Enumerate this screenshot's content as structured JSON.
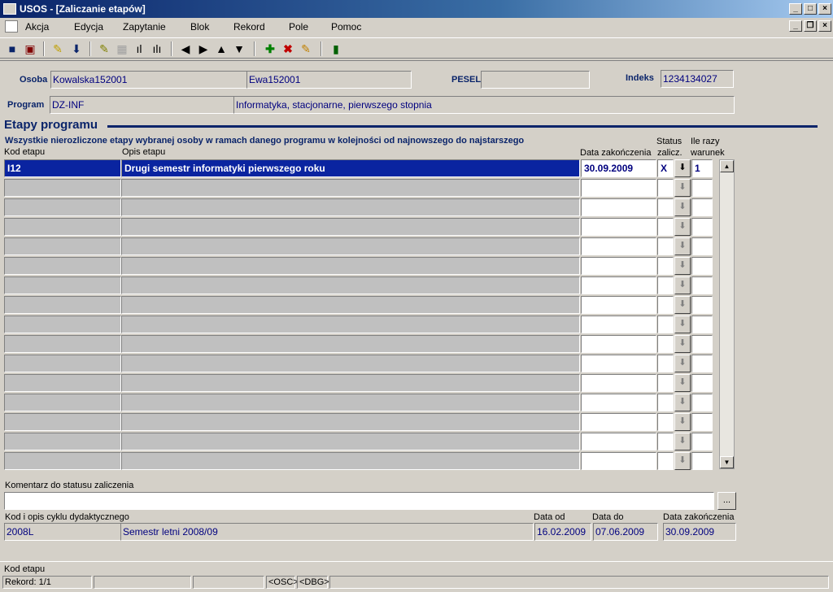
{
  "window": {
    "title": "USOS - [Zaliczanie etapów]"
  },
  "menu": [
    "Akcja",
    "Edycja",
    "Zapytanie",
    "Blok",
    "Rekord",
    "Pole",
    "Pomoc"
  ],
  "toolbar_icons": [
    "save-icon",
    "print-icon",
    "edit-icon",
    "download-icon",
    "query-icon",
    "query-disabled-icon",
    "count-icon",
    "count-alt-icon",
    "prev-record-icon",
    "next-record-icon",
    "prev-block-icon",
    "next-block-icon",
    "insert-record-icon",
    "delete-record-icon",
    "clear-record-icon",
    "exit-icon"
  ],
  "form": {
    "osoba_label": "Osoba",
    "osoba_surname": "Kowalska152001",
    "osoba_name": "Ewa152001",
    "pesel_label": "PESEL",
    "pesel_value": "",
    "indeks_label": "Indeks",
    "indeks_value": "1234134027",
    "program_label": "Program",
    "program_code": "DZ-INF",
    "program_desc": "Informatyka, stacjonarne, pierwszego stopnia"
  },
  "etapy": {
    "section_title": "Etapy programu",
    "description": "Wszystkie nierozliczone etapy wybranej osoby w ramach danego programu w kolejności od najnowszego do najstarszego",
    "col_kod": "Kod etapu",
    "col_opis": "Opis etapu",
    "col_data": "Data zakończenia",
    "col_status_1": "Status",
    "col_status_2": "zalicz.",
    "col_ile_1": "Ile razy",
    "col_ile_2": "warunek",
    "rows": [
      {
        "kod": "I12",
        "opis": "Drugi semestr informatyki pierwszego roku",
        "data": "30.09.2009",
        "status": "X",
        "ile": "1"
      }
    ]
  },
  "komentarz": {
    "label": "Komentarz do statusu zaliczenia",
    "value": "",
    "button": "..."
  },
  "cykl": {
    "label": "Kod i opis cyklu dydaktycznego",
    "code": "2008L",
    "desc": "Semestr letni 2008/09",
    "od_label": "Data od",
    "od_value": "16.02.2009",
    "do_label": "Data do",
    "do_value": "07.06.2009",
    "zak_label": "Data zakończenia",
    "zak_value": "30.09.2009"
  },
  "status": {
    "hint": "Kod etapu",
    "record": "Rekord: 1/1",
    "osc": "<OSC>",
    "dbg": "<DBG>"
  }
}
